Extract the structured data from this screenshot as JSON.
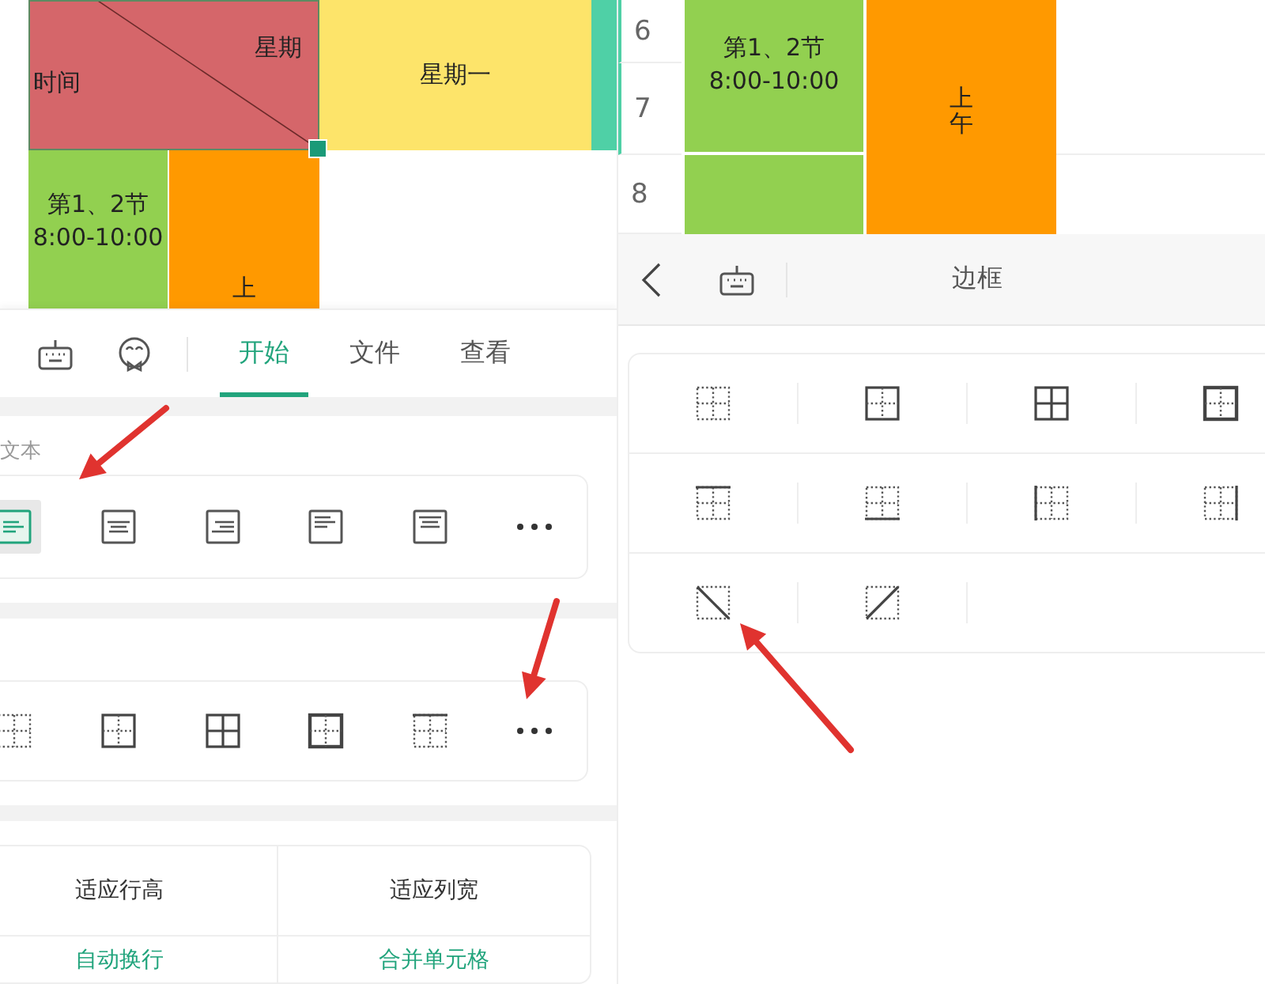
{
  "left": {
    "sheet": {
      "corner": {
        "column_label": "星期",
        "row_label": "时间"
      },
      "day_header": "星期一",
      "period": "第1、2节\n8:00-10:00",
      "half_day": "上"
    },
    "toolbar": {
      "tabs": [
        {
          "label": "开始",
          "selected": true
        },
        {
          "label": "文件",
          "selected": false
        },
        {
          "label": "查看",
          "selected": false
        }
      ]
    },
    "text_section": {
      "label": "文本",
      "alignments": [
        {
          "kind": "left",
          "selected": true
        },
        {
          "kind": "center",
          "selected": false
        },
        {
          "kind": "right",
          "selected": false
        },
        {
          "kind": "topleft",
          "selected": false
        },
        {
          "kind": "topcenter",
          "selected": false
        }
      ]
    },
    "border_section": {
      "borders": [
        {
          "kind": "none"
        },
        {
          "kind": "outer"
        },
        {
          "kind": "all"
        },
        {
          "kind": "thick"
        },
        {
          "kind": "top"
        }
      ]
    },
    "actions": [
      {
        "label": "适应行高",
        "kind": "command"
      },
      {
        "label": "适应列宽",
        "kind": "command"
      },
      {
        "label": "自动换行",
        "kind": "option"
      },
      {
        "label": "合并单元格",
        "kind": "option"
      }
    ]
  },
  "right": {
    "sheet": {
      "row_numbers": [
        "6",
        "7",
        "8"
      ],
      "period": "第1、2节\n8:00-10:00",
      "half_day": "上午"
    },
    "header": {
      "title": "边框"
    },
    "borders": [
      [
        {
          "kind": "none"
        },
        {
          "kind": "outer"
        },
        {
          "kind": "all"
        },
        {
          "kind": "thick"
        }
      ],
      [
        {
          "kind": "top"
        },
        {
          "kind": "bottom"
        },
        {
          "kind": "left"
        },
        {
          "kind": "right"
        }
      ],
      [
        {
          "kind": "diagdown"
        },
        {
          "kind": "diagup"
        }
      ]
    ]
  }
}
